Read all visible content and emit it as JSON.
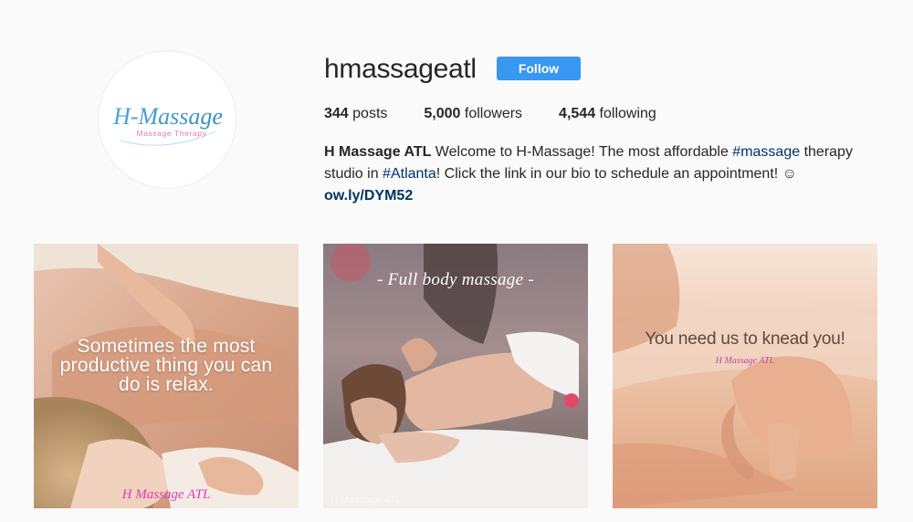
{
  "profile": {
    "username": "hmassageatl",
    "follow_label": "Follow",
    "avatar": {
      "logo_text": "H-Massage",
      "logo_subtext": "Massage Therapy",
      "logo_color": "#4a9ecb",
      "sub_color": "#e07ab8"
    },
    "stats": {
      "posts_count": "344",
      "posts_label": "posts",
      "followers_count": "5,000",
      "followers_label": "followers",
      "following_count": "4,544",
      "following_label": "following"
    },
    "bio": {
      "name": "H Massage ATL",
      "text_1": " Welcome to H-Massage! The most affordable ",
      "hashtag_1": "#massage",
      "text_2": " therapy studio in ",
      "hashtag_2": "#Atlanta",
      "text_3": "! Click the link in our bio to schedule an appointment! ☺",
      "link": "ow.ly/DYM52"
    }
  },
  "posts": [
    {
      "caption_lines": [
        "Sometimes the most",
        "productive thing you can",
        "do is relax."
      ],
      "watermark": "H Massage ATL"
    },
    {
      "caption": "- Full body massage -",
      "watermark": "H Massage ATL"
    },
    {
      "caption": "You need us to knead you!",
      "watermark": "H Massage ATL"
    }
  ],
  "colors": {
    "accent": "#3897f0",
    "link": "#003569",
    "text": "#262626",
    "background": "#fafafa"
  }
}
